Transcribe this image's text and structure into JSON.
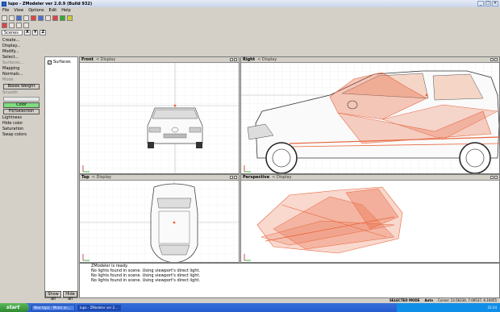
{
  "window": {
    "title": "lupo - ZModeler ver 2.0.9 (Build 932)",
    "controls": [
      "_",
      "□",
      "×"
    ]
  },
  "menu": [
    "File",
    "View",
    "Options",
    "Edit",
    "Help"
  ],
  "toolbar": {
    "scene_select": "Scenes",
    "axis": [
      "X",
      "Y",
      "Z"
    ]
  },
  "left_panel": {
    "items": [
      "Create...",
      "Display...",
      "Modify...",
      "Select...",
      "Surfaces...",
      "Mapping",
      "Normals..."
    ],
    "dim_items": [
      "Mode",
      "Smooth",
      "Tools"
    ],
    "smooth_btn": "Boxes Weight",
    "color_btn": "Color",
    "fill_btn": "Fill/Selection",
    "tools": [
      "Lightness",
      "Hide color",
      "Saturation",
      "Swap colors"
    ]
  },
  "side": {
    "surfaces_label": "Surfaces",
    "show_all": "Show all",
    "hide_all": "Hide all"
  },
  "viewports": {
    "front": {
      "name": "Front",
      "display": "< Display"
    },
    "right": {
      "name": "Right",
      "display": "< Display"
    },
    "top": {
      "name": "Top",
      "display": "< Display"
    },
    "perspective": {
      "name": "Perspective",
      "display": "< Display"
    }
  },
  "console": [
    "ZModeler is ready.",
    "No lights found in scene. Using viewport's direct light.",
    "No lights found in scene. Using viewport's direct light.",
    "No lights found in scene. Using viewport's direct light."
  ],
  "status": {
    "mode": "SELECTED MODE",
    "auto": "Auto",
    "cursor": "Cursor: 13.56234, 7.00537, 6.16455"
  },
  "taskbar": {
    "start": "start",
    "tasks": [
      "New topic - Motor on...",
      "lupo - ZModeler ver 2..."
    ],
    "tray": "23:34"
  },
  "colors": {
    "accent": "#e8643c",
    "grid": "#e6e6e6"
  }
}
